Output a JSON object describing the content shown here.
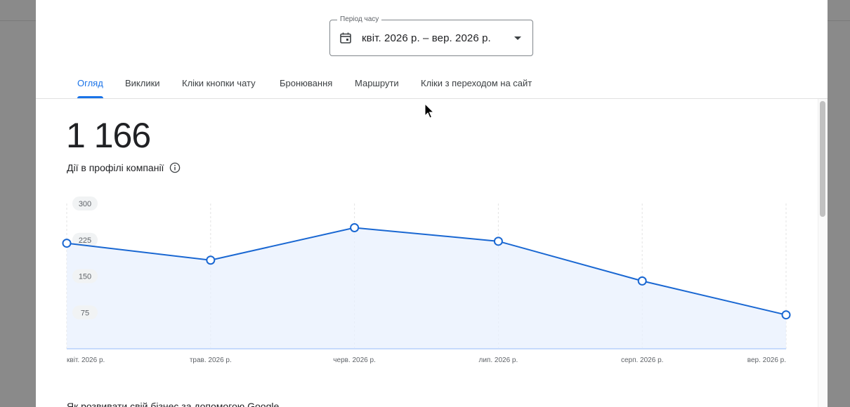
{
  "period": {
    "legend": "Період часу",
    "value": "квіт. 2026 р. – вер. 2026 р."
  },
  "tabs": [
    {
      "label": "Огляд",
      "active": true
    },
    {
      "label": "Виклики",
      "active": false
    },
    {
      "label": "Кліки кнопки чату",
      "active": false
    },
    {
      "label": "Бронювання",
      "active": false
    },
    {
      "label": "Маршрути",
      "active": false
    },
    {
      "label": "Кліки з переходом на сайт",
      "active": false
    }
  ],
  "metric": {
    "value": "1 166",
    "label": "Дії в профілі компанії"
  },
  "chart_data": {
    "type": "area",
    "categories": [
      "квіт. 2026 р.",
      "трав. 2026 р.",
      "черв. 2026 р.",
      "лип. 2026 р.",
      "серп. 2026 р.",
      "вер. 2026 р."
    ],
    "series": [
      {
        "values": [
          218,
          183,
          250,
          222,
          140,
          70
        ]
      }
    ],
    "yticks": [
      "300",
      "225",
      "150",
      "75"
    ],
    "ylim": [
      0,
      300
    ],
    "grid": "vertical-dashed",
    "color": "#1967d2"
  },
  "footer": {
    "heading": "Як розвивати свій бізнес за допомогою Google"
  }
}
